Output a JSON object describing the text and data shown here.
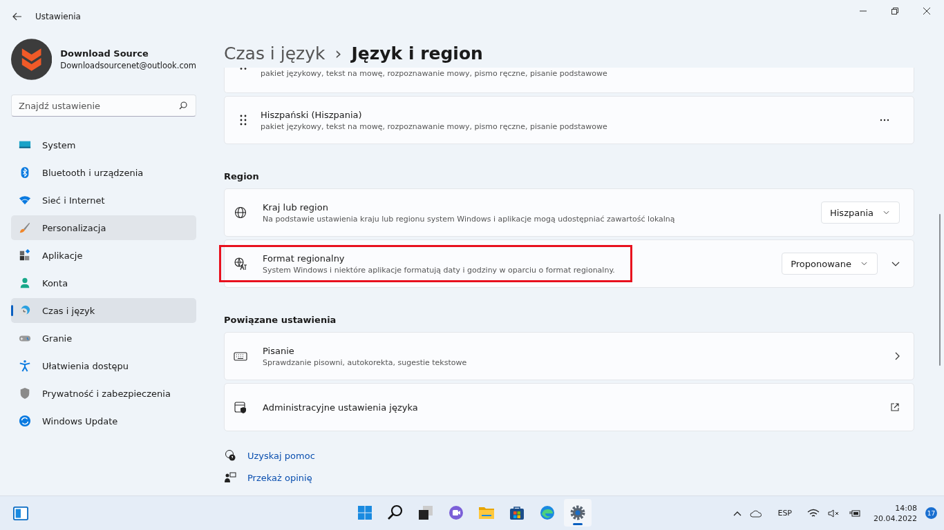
{
  "window": {
    "title": "Ustawienia"
  },
  "account": {
    "name": "Download Source",
    "email": "Downloadsourcenet@outlook.com"
  },
  "search": {
    "placeholder": "Znajdź ustawienie"
  },
  "sidebar": {
    "items": [
      {
        "label": "System",
        "selected": false,
        "hovered": false
      },
      {
        "label": "Bluetooth i urządzenia",
        "selected": false,
        "hovered": false
      },
      {
        "label": "Sieć i Internet",
        "selected": false,
        "hovered": false
      },
      {
        "label": "Personalizacja",
        "selected": false,
        "hovered": true
      },
      {
        "label": "Aplikacje",
        "selected": false,
        "hovered": false
      },
      {
        "label": "Konta",
        "selected": false,
        "hovered": false
      },
      {
        "label": "Czas i język",
        "selected": true,
        "hovered": false
      },
      {
        "label": "Granie",
        "selected": false,
        "hovered": false
      },
      {
        "label": "Ułatwienia dostępu",
        "selected": false,
        "hovered": false
      },
      {
        "label": "Prywatność i zabezpieczenia",
        "selected": false,
        "hovered": false
      },
      {
        "label": "Windows Update",
        "selected": false,
        "hovered": false
      }
    ]
  },
  "breadcrumb": {
    "parent": "Czas i język",
    "separator": "›",
    "current": "Język i region"
  },
  "languages": [
    {
      "description": "pakiet językowy, tekst na mowę, rozpoznawanie mowy, pismo ręczne, pisanie podstawowe",
      "cut": true
    },
    {
      "title": "Hiszpański (Hiszpania)",
      "description": "pakiet językowy, tekst na mowę, rozpoznawanie mowy, pismo ręczne, pisanie podstawowe",
      "cut": false
    }
  ],
  "sections": [
    {
      "heading": "Region",
      "rows": [
        {
          "kind": "dropdown",
          "title": "Kraj lub region",
          "description": "Na podstawie ustawienia kraju lub regionu system Windows i aplikacje mogą udostępniać zawartość lokalną",
          "value": "Hiszpania",
          "highlighted": false,
          "expandable": false
        },
        {
          "kind": "dropdown",
          "title": "Format regionalny",
          "description": "System Windows i niektóre aplikacje formatują daty i godziny w oparciu o format regionalny.",
          "value": "Proponowane",
          "highlighted": true,
          "expandable": true
        }
      ]
    },
    {
      "heading": "Powiązane ustawienia",
      "rows": [
        {
          "kind": "link",
          "title": "Pisanie",
          "description": "Sprawdzanie pisowni, autokorekta, sugestie tekstowe",
          "highlighted": false
        },
        {
          "kind": "external",
          "title": "Administracyjne ustawienia języka",
          "highlighted": false
        }
      ]
    }
  ],
  "help_links": [
    {
      "label": "Uzyskaj pomoc"
    },
    {
      "label": "Przekaż opinię"
    }
  ],
  "taskbar": {
    "apps": [
      {
        "active": false
      },
      {
        "active": false
      },
      {
        "active": false
      },
      {
        "active": false
      },
      {
        "active": false
      },
      {
        "active": false
      },
      {
        "active": false
      },
      {
        "active": true
      }
    ],
    "language": "ESP",
    "time": "14:08",
    "date": "20.04.2022",
    "notifications": "17"
  }
}
